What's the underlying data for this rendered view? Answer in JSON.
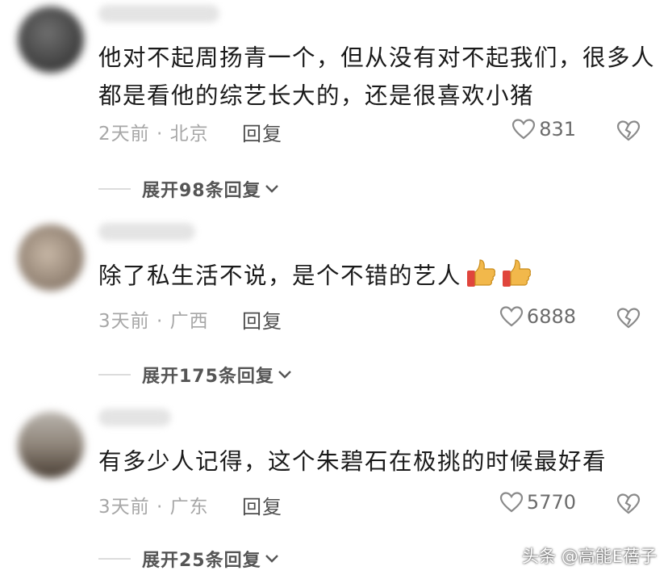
{
  "comments": [
    {
      "text": "他对不起周扬青一个，但从没有对不起我们，很多人都是看他的综艺长大的，还是很喜欢小猪",
      "meta": "2天前 · 北京",
      "reply_label": "回复",
      "likes": "831",
      "expand_label": "展开98条回复"
    },
    {
      "text": "除了私生活不说，是个不错的艺人",
      "meta": "3天前 · 广西",
      "reply_label": "回复",
      "likes": "6888",
      "expand_label": "展开175条回复"
    },
    {
      "text": "有多少人记得，这个朱碧石在极挑的时候最好看",
      "meta": "3天前 · 广东",
      "reply_label": "回复",
      "likes": "5770",
      "expand_label": "展开25条回复"
    }
  ],
  "watermark": "头条 @高能E蓓子",
  "colors": {
    "text": "#1a1a1a",
    "meta": "#a7a7a7",
    "reply": "#4d4d4d",
    "thumb": "#f2b84b",
    "thumb_sleeve": "#e0453c"
  }
}
